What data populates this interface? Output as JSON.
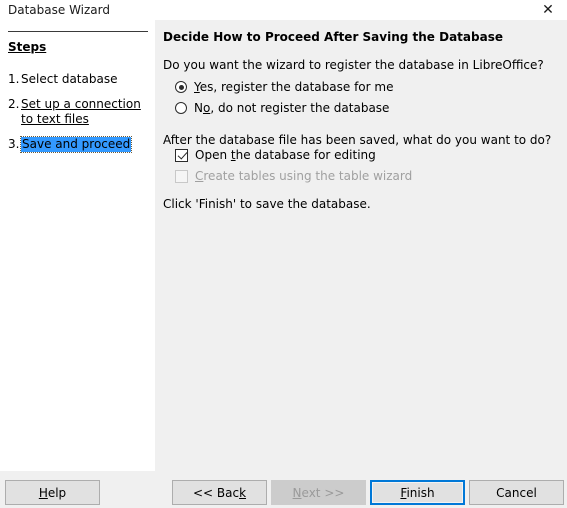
{
  "window": {
    "title": "Database Wizard",
    "close_icon": "close-icon",
    "close_glyph": "✕"
  },
  "sidebar": {
    "heading": "Steps",
    "steps": [
      {
        "number": "1.",
        "label": "Select database",
        "state": "done"
      },
      {
        "number": "2.",
        "label": "Set up a connection to text files",
        "state": "link"
      },
      {
        "number": "3.",
        "label": "Save and proceed",
        "state": "current"
      }
    ]
  },
  "main": {
    "heading": "Decide How to Proceed After Saving the Database",
    "question_register": "Do you want the wizard to register the database in LibreOffice?",
    "radios": [
      {
        "id": "yes",
        "mnemonic": "Y",
        "rest": "es, register the database for me",
        "full_label": "Yes, register the database for me",
        "checked": true,
        "disabled": false
      },
      {
        "id": "no",
        "prefix": "N",
        "mnemonic": "o",
        "rest": ", do not register the database",
        "full_label": "No, do not register the database",
        "checked": false,
        "disabled": false
      }
    ],
    "question_after": "After the database file has been saved, what do you want to do?",
    "checkboxes": [
      {
        "id": "open-for-editing",
        "prefix": "Open ",
        "mnemonic": "t",
        "rest": "he database for editing",
        "full_label": "Open the database for editing",
        "checked": true,
        "disabled": false
      },
      {
        "id": "create-tables",
        "mnemonic": "C",
        "rest": "reate tables using the table wizard",
        "full_label": "Create tables using the table wizard",
        "checked": false,
        "disabled": true
      }
    ],
    "closing_line": "Click 'Finish' to save the database."
  },
  "buttons": {
    "help": {
      "mnemonic": "H",
      "rest": "elp",
      "full_label": "Help",
      "disabled": false,
      "default": false
    },
    "back": {
      "prefix": "<< Bac",
      "mnemonic": "k",
      "rest": "",
      "full_label": "<< Back",
      "disabled": false,
      "default": false
    },
    "next": {
      "mnemonic": "N",
      "rest": "ext >>",
      "full_label": "Next >>",
      "disabled": true,
      "default": false
    },
    "finish": {
      "mnemonic": "F",
      "rest": "inish",
      "full_label": "Finish",
      "disabled": false,
      "default": true
    },
    "cancel": {
      "full_label": "Cancel",
      "disabled": false,
      "default": false
    }
  },
  "colors": {
    "accent": "#0078d7",
    "selection": "#3399ff",
    "panel": "#f0f0f0",
    "sidebar": "#ffffff",
    "button_face": "#e1e1e1",
    "disabled_text": "#9a9a9a"
  }
}
